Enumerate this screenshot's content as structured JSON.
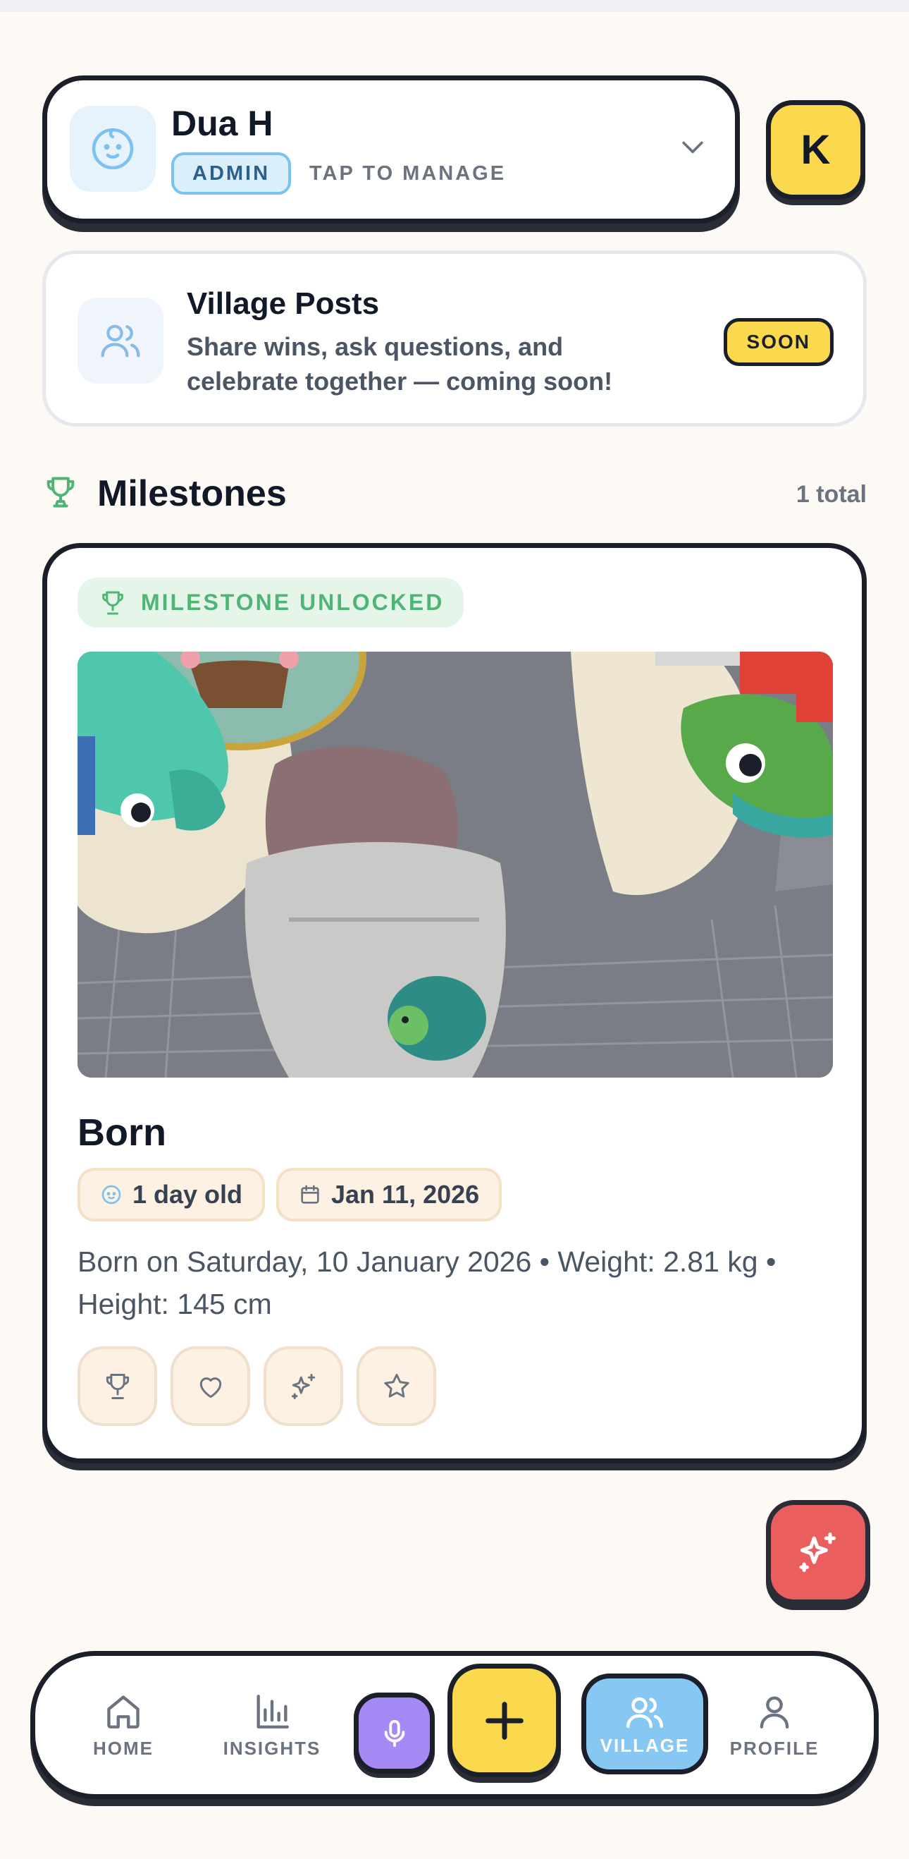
{
  "child": {
    "name": "Dua H",
    "role_badge": "ADMIN",
    "manage_label": "TAP TO MANAGE"
  },
  "account": {
    "initial": "K"
  },
  "posts": {
    "title": "Village Posts",
    "description": "Share wins, ask questions, and celebrate together — coming soon!",
    "badge": "SOON"
  },
  "milestones": {
    "section_title": "Milestones",
    "total_label": "1 total",
    "items": [
      {
        "badge": "MILESTONE UNLOCKED",
        "title": "Born",
        "age_chip": "1 day old",
        "date_chip": "Jan 11, 2026",
        "description": "Born on Saturday, 10 January 2026 • Weight: 2.81 kg • Height: 145 cm",
        "reactions": [
          "trophy-icon",
          "heart-icon",
          "sparkles-icon",
          "star-icon"
        ]
      }
    ]
  },
  "nav": {
    "home": "HOME",
    "insights": "INSIGHTS",
    "village": "VILLAGE",
    "profile": "PROFILE"
  },
  "colors": {
    "background": "#fdf9f4",
    "accent_yellow": "#fbd94f",
    "accent_blue": "#86c8f2",
    "accent_purple": "#a58af6",
    "accent_red": "#ea5e5e",
    "success_green": "#4fb576",
    "ink": "#1b1f2a"
  }
}
